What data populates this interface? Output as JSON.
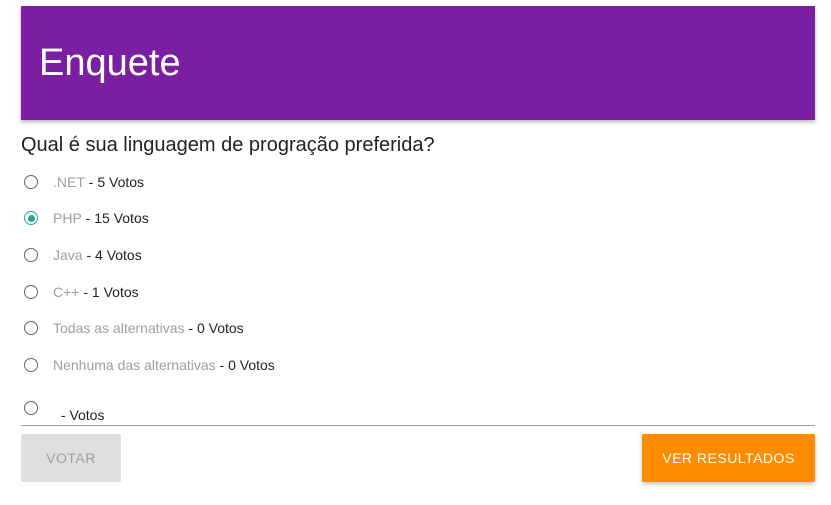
{
  "header": {
    "title": "Enquete"
  },
  "question": "Qual é sua linguagem de progração preferida?",
  "options": [
    {
      "name": ".NET",
      "votes": " - 5 Votos",
      "checked": false
    },
    {
      "name": "PHP",
      "votes": " - 15 Votos",
      "checked": true
    },
    {
      "name": "Java",
      "votes": " - 4 Votos",
      "checked": false
    },
    {
      "name": "C++",
      "votes": " - 1 Votos",
      "checked": false
    },
    {
      "name": "Todas as alternativas",
      "votes": " - 0 Votos",
      "checked": false
    },
    {
      "name": "Nenhuma das alternativas",
      "votes": " - 0 Votos",
      "checked": false
    },
    {
      "name": "",
      "votes": " - Votos",
      "checked": false
    }
  ],
  "buttons": {
    "vote": "VOTAR",
    "results": "VER RESULTADOS"
  },
  "colors": {
    "header": "#7b1fa2",
    "accent": "#26a69a",
    "results_button": "#ff8c00"
  }
}
